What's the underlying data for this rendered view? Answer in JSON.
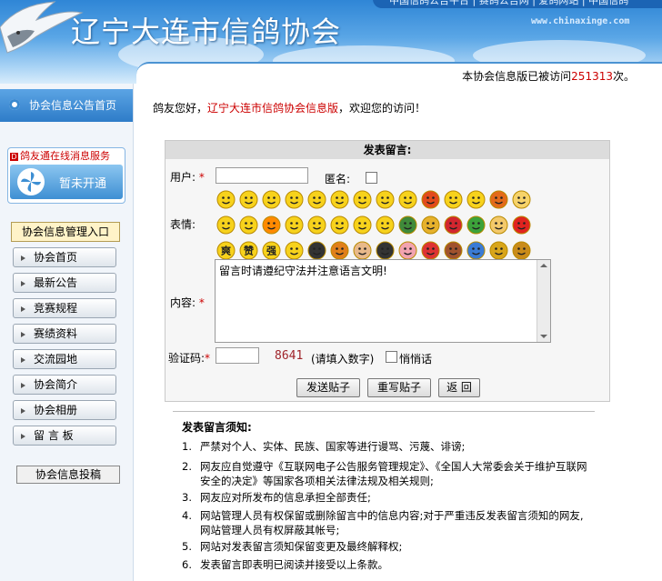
{
  "header": {
    "site_title": "辽宁大连市信鸽协会",
    "top_link": "中国信鸽公告平台 | 赛鸽公告网 | 爱鸽网站 | 中国信鸽",
    "watermark": "www.chinaxinge.com",
    "visit_prefix": "本协会信息版已被访问",
    "visit_count": "251313",
    "visit_suffix": "次。"
  },
  "sidebar": {
    "home_label": "协会信息公告首页",
    "service_title": "鸽友通在线消息服务",
    "service_status": "暂未开通",
    "mgmt_label": "协会信息管理入口",
    "nav": [
      {
        "label": "协会首页"
      },
      {
        "label": "最新公告"
      },
      {
        "label": "竞赛规程"
      },
      {
        "label": "赛绩资料"
      },
      {
        "label": "交流园地"
      },
      {
        "label": "协会简介"
      },
      {
        "label": "协会相册"
      },
      {
        "label": "留 言 板"
      }
    ],
    "post_label": "协会信息投稿"
  },
  "greeting": {
    "prefix": "鸽友您好，",
    "link": "辽宁大连市信鸽协会信息版",
    "suffix": "，欢迎您的访问！"
  },
  "form": {
    "title": "发表留言:",
    "user_label": "用户:",
    "user_value": "",
    "anonymous_label": "匿名:",
    "emotion_label": "表情:",
    "content_label": "内容:",
    "content_value": "留言时请遵纪守法并注意语言文明!",
    "captcha_label": "验证码:",
    "captcha_value": "",
    "captcha_code": "8641",
    "captcha_hint": "(请填入数字)",
    "whisper_label": "悄悄话",
    "required_mark": "*",
    "submit_label": "发送贴子",
    "reset_label": "重写贴子",
    "back_label": "返 回"
  },
  "emotions": {
    "icons": [
      "thumbs-up",
      "shy-face",
      "love-face",
      "laughing-face",
      "cool-face",
      "surprised-face",
      "kiss-face",
      "wondering-face",
      "confused-face",
      "angry-face",
      "grin-face",
      "crying-face",
      "mad-face",
      "beer-mug",
      "yawn-face",
      "sick-face",
      "fire-face",
      "smile-face",
      "teeth-face",
      "wink-face",
      "bruised-face",
      "sleepy-face",
      "turtle",
      "pineapple",
      "ribbon",
      "watermelon",
      "cake",
      "tomato",
      "cool-badge",
      "great-badge",
      "strong-badge",
      "chuckle-face",
      "penguin",
      "devil-face",
      "handshake",
      "penguin-two",
      "pig-face",
      "pill",
      "coffee-cup",
      "gift-box",
      "trophy",
      "money-bag"
    ],
    "text_badges": {
      "cool-badge": "爽",
      "great-badge": "赞",
      "strong-badge": "强"
    }
  },
  "notice": {
    "title": "发表留言须知:",
    "rules": [
      {
        "n": "1.",
        "text": "严禁对个人、实体、民族、国家等进行谩骂、污蔑、诽谤;"
      },
      {
        "n": "2.",
        "text": "网友应自觉遵守《互联网电子公告服务管理规定》、《全国人大常委会关于维护互联网安全的决定》等国家各项相关法律法规及相关规则;"
      },
      {
        "n": "3.",
        "text": "网友应对所发布的信息承担全部责任;"
      },
      {
        "n": "4.",
        "text": "网站管理人员有权保留或删除留言中的信息内容;对于严重违反发表留言须知的网友,网站管理人员有权屏蔽其帐号;"
      },
      {
        "n": "5.",
        "text": "网站对发表留言须知保留变更及最终解释权;"
      },
      {
        "n": "6.",
        "text": "发表留言即表明已阅读并接受以上条款。"
      }
    ]
  }
}
